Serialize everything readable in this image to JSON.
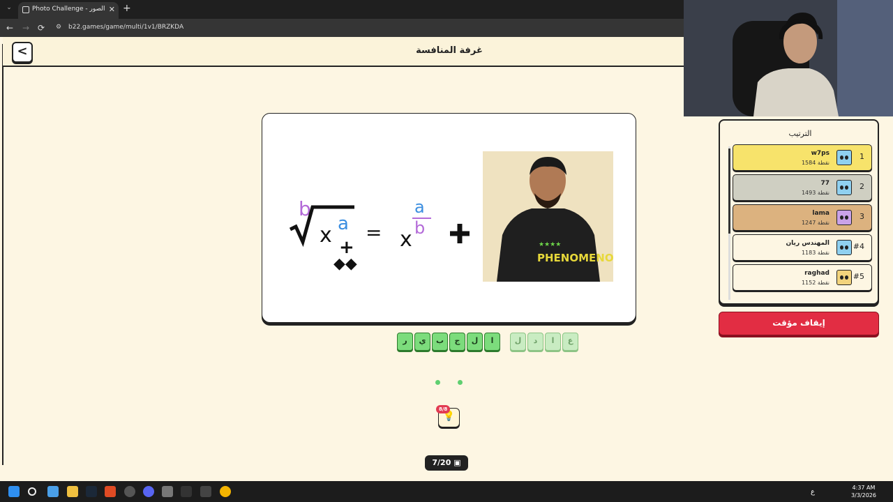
{
  "browser": {
    "tab_title": "Photo Challenge - تحدي الصور",
    "tab_close": "✕",
    "new_tab": "+",
    "url": "b22.games/game/multi/1v1/BRZKDA",
    "back": "←",
    "forward": "→",
    "reload": "⟳"
  },
  "page": {
    "title": "غرفة المنافسة",
    "back_glyph": "<"
  },
  "puzzle": {
    "letters_filled": [
      "ر",
      "ي",
      "ب",
      "ج",
      "ل",
      "ا"
    ],
    "letters_hint": [
      "ل",
      "د",
      "ا",
      "ع"
    ]
  },
  "hint": {
    "badge": "8/8",
    "icon": "lightbulb-icon"
  },
  "progress": {
    "label": "7/20",
    "icon": "image-icon"
  },
  "ranking": {
    "title": "الترتيب",
    "rows": [
      {
        "rank": "1",
        "name": "w7ps",
        "score": "1584 نقطة",
        "color": "#f7e36b",
        "avatar_color": "#8fd0f0"
      },
      {
        "rank": "2",
        "name": "77",
        "score": "1493 نقطة",
        "color": "#cfcfc2",
        "avatar_color": "#8fd0f0"
      },
      {
        "rank": "3",
        "name": "lama",
        "score": "1247 نقطة",
        "color": "#dcb27f",
        "avatar_color": "#c9a2e8"
      },
      {
        "rank": "#4",
        "name": "المهندس ريان",
        "score": "1183 نقطة",
        "color": "#fdf6e3",
        "avatar_color": "#8fd0f0"
      },
      {
        "rank": "#5",
        "name": "raghad",
        "score": "1152 نقطة",
        "color": "#fdf6e3",
        "avatar_color": "#f2d37c"
      }
    ]
  },
  "pause_button": "إيقاف مؤقت",
  "taskbar": {
    "time": "4:37 AM",
    "date": "3/3/2026",
    "lang": "ع"
  },
  "colors": {
    "accent_red": "#e22d43",
    "tile_green": "#7cdc7c",
    "page_bg": "#fdf6e3"
  }
}
